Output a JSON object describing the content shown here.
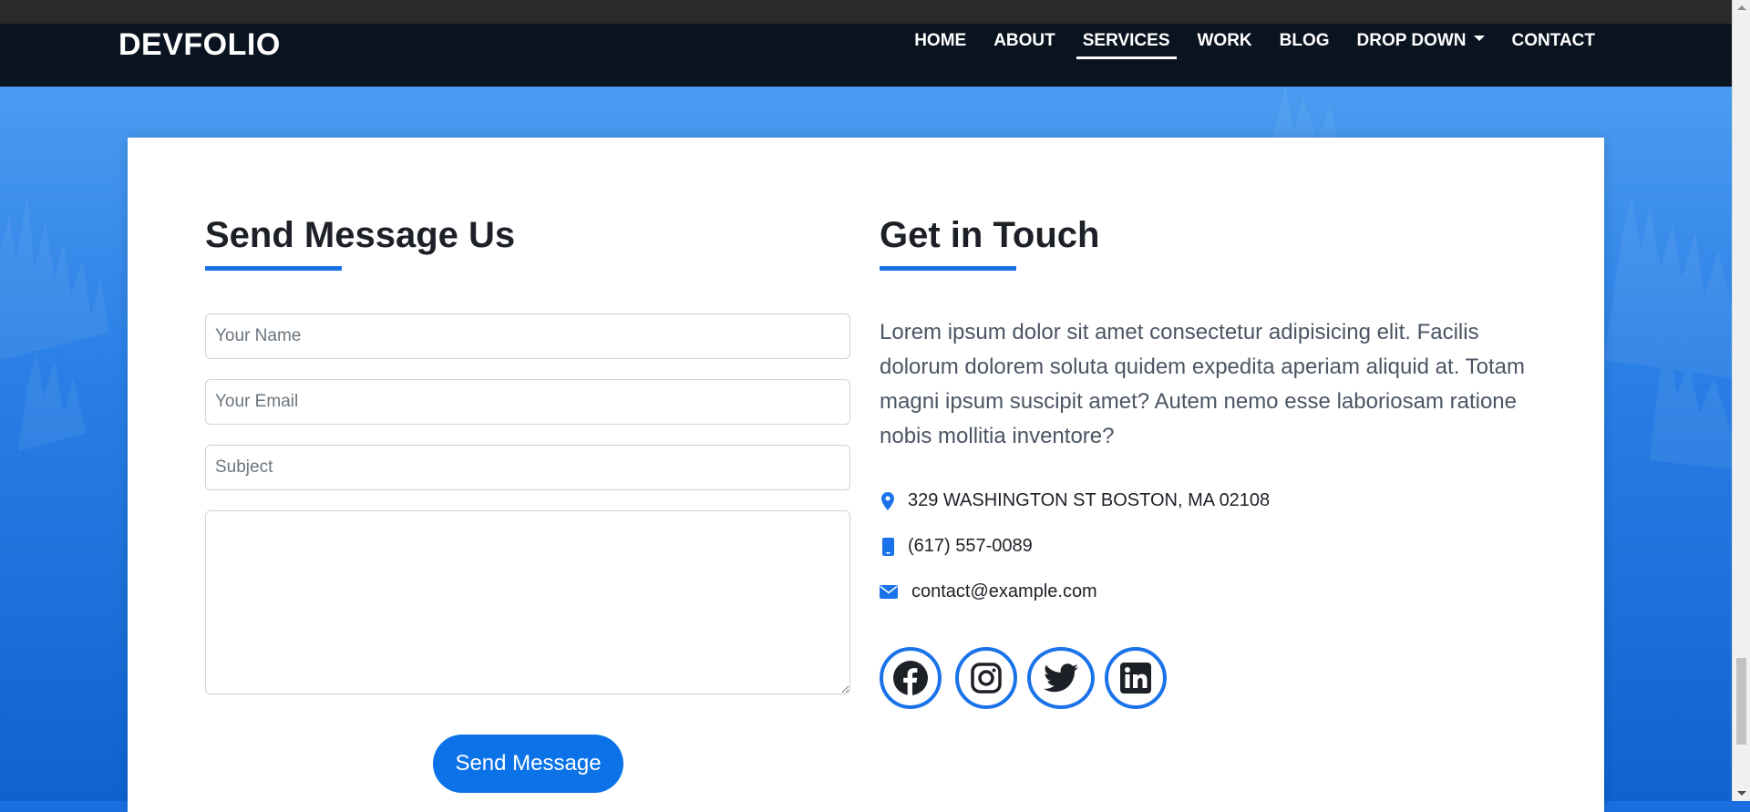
{
  "brand": "DEVFOLIO",
  "nav": {
    "items": [
      {
        "label": "HOME"
      },
      {
        "label": "ABOUT"
      },
      {
        "label": "SERVICES",
        "active": true
      },
      {
        "label": "WORK"
      },
      {
        "label": "BLOG"
      },
      {
        "label": "DROP DOWN",
        "dropdown": true
      },
      {
        "label": "CONTACT"
      }
    ]
  },
  "form": {
    "title": "Send Message Us",
    "name_placeholder": "Your Name",
    "email_placeholder": "Your Email",
    "subject_placeholder": "Subject",
    "message_value": "",
    "send_label": "Send Message"
  },
  "contact": {
    "title": "Get in Touch",
    "description": "Lorem ipsum dolor sit amet consectetur adipisicing elit. Facilis dolorum dolorem soluta quidem expedita aperiam aliquid at. Totam magni ipsum suscipit amet? Autem nemo esse laboriosam ratione nobis mollitia inventore?",
    "address": "329 WASHINGTON ST BOSTON, MA 02108",
    "phone": "(617) 557-0089",
    "email": "contact@example.com",
    "icons": [
      "map-marker-icon",
      "phone-icon",
      "envelope-icon"
    ]
  },
  "social": [
    "facebook-icon",
    "instagram-icon",
    "twitter-icon",
    "linkedin-icon"
  ],
  "colors": {
    "accent": "#1a73e8",
    "navbar_bg": "#0a1320",
    "button": "#0b72e7"
  }
}
